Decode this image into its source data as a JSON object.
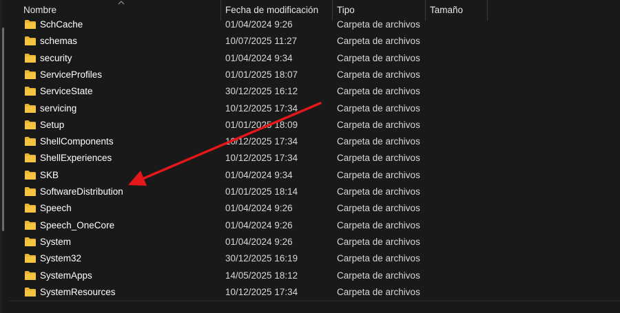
{
  "columns": {
    "name": "Nombre",
    "date": "Fecha de modificación",
    "type": "Tipo",
    "size": "Tamaño"
  },
  "icons": {
    "folder": "folder-icon",
    "sort": "chevron-up-icon",
    "annotation": "red-arrow-annotation"
  },
  "colors": {
    "folder": "#f5c542",
    "arrow": "#e5171a"
  },
  "rows": [
    {
      "name": "SchCache",
      "date": "01/04/2024 9:26",
      "type": "Carpeta de archivos"
    },
    {
      "name": "schemas",
      "date": "10/07/2025 11:27",
      "type": "Carpeta de archivos"
    },
    {
      "name": "security",
      "date": "01/04/2024 9:34",
      "type": "Carpeta de archivos"
    },
    {
      "name": "ServiceProfiles",
      "date": "01/01/2025 18:07",
      "type": "Carpeta de archivos"
    },
    {
      "name": "ServiceState",
      "date": "30/12/2025 16:12",
      "type": "Carpeta de archivos"
    },
    {
      "name": "servicing",
      "date": "10/12/2025 17:34",
      "type": "Carpeta de archivos"
    },
    {
      "name": "Setup",
      "date": "01/01/2025 18:09",
      "type": "Carpeta de archivos"
    },
    {
      "name": "ShellComponents",
      "date": "10/12/2025 17:34",
      "type": "Carpeta de archivos"
    },
    {
      "name": "ShellExperiences",
      "date": "10/12/2025 17:34",
      "type": "Carpeta de archivos"
    },
    {
      "name": "SKB",
      "date": "01/04/2024 9:34",
      "type": "Carpeta de archivos"
    },
    {
      "name": "SoftwareDistribution",
      "date": "01/01/2025 18:14",
      "type": "Carpeta de archivos"
    },
    {
      "name": "Speech",
      "date": "01/04/2024 9:26",
      "type": "Carpeta de archivos"
    },
    {
      "name": "Speech_OneCore",
      "date": "01/04/2024 9:26",
      "type": "Carpeta de archivos"
    },
    {
      "name": "System",
      "date": "01/04/2024 9:26",
      "type": "Carpeta de archivos"
    },
    {
      "name": "System32",
      "date": "30/12/2025 16:19",
      "type": "Carpeta de archivos"
    },
    {
      "name": "SystemApps",
      "date": "14/05/2025 18:12",
      "type": "Carpeta de archivos"
    },
    {
      "name": "SystemResources",
      "date": "10/12/2025 17:34",
      "type": "Carpeta de archivos"
    }
  ]
}
